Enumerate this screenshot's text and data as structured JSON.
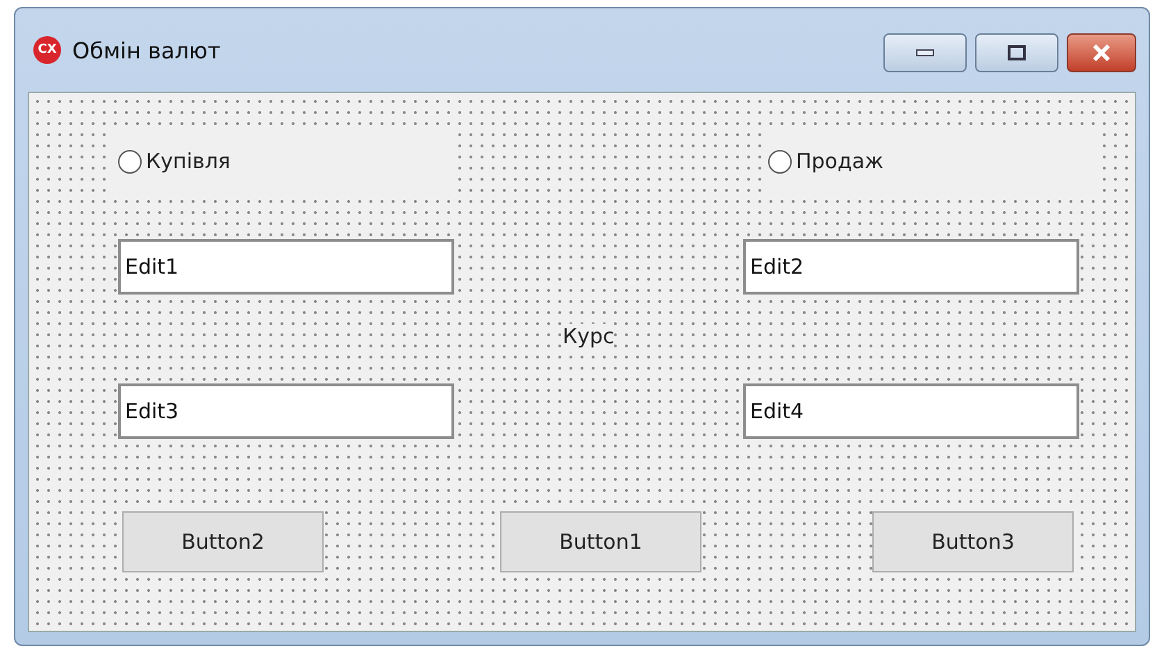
{
  "window": {
    "icon_text": "CX",
    "title": "Обмін валют"
  },
  "radios": [
    {
      "label": "Купівля",
      "selected": false
    },
    {
      "label": "Продаж",
      "selected": false
    }
  ],
  "edits": [
    {
      "value": "Edit1"
    },
    {
      "value": "Edit2"
    },
    {
      "value": "Edit3"
    },
    {
      "value": "Edit4"
    }
  ],
  "rate_label": "Курс",
  "buttons": [
    "Button2",
    "Button1",
    "Button3"
  ]
}
